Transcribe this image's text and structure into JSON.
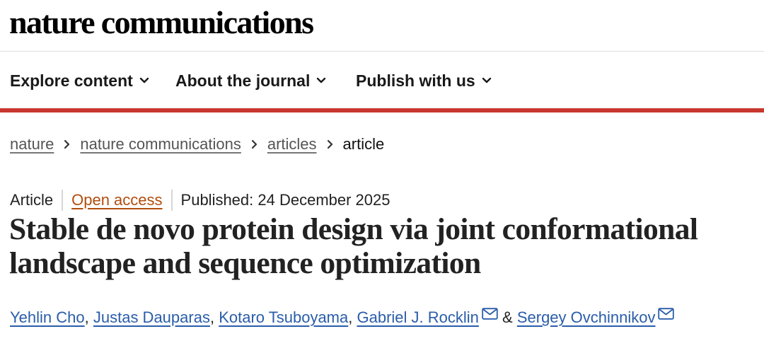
{
  "masthead": {
    "logo_text": "nature communications"
  },
  "nav": {
    "items": [
      {
        "label": "Explore content"
      },
      {
        "label": "About the journal"
      },
      {
        "label": "Publish with us"
      }
    ]
  },
  "breadcrumb": {
    "items": [
      "nature",
      "nature communications",
      "articles"
    ],
    "current": "article"
  },
  "article": {
    "type": "Article",
    "access": "Open access",
    "published": "Published: 24 December 2025",
    "title": "Stable de novo protein design via joint conformational landscape and sequence optimization",
    "authors": [
      "Yehlin Cho",
      "Justas Dauparas",
      "Kotaro Tsuboyama",
      "Gabriel J. Rocklin",
      "Sergey Ovchinnikov"
    ],
    "author_separator": ",",
    "ampersand": "&"
  },
  "colors": {
    "accent_red": "#c8372d",
    "link_blue": "#2a5daa",
    "open_access_orange": "#b24d0f"
  },
  "icons": {
    "nav_chevron": "chevron-down-icon",
    "crumb_separator": "chevron-right-icon",
    "author_contact": "envelope-icon"
  }
}
